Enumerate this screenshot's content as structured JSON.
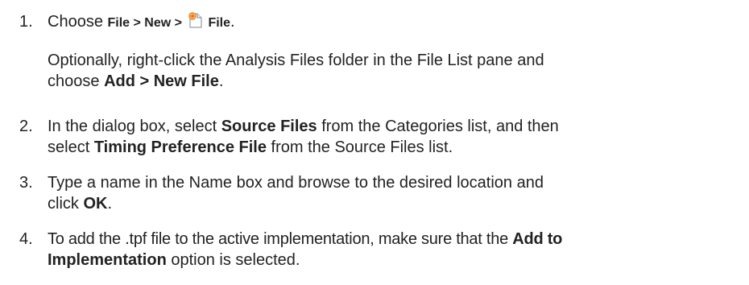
{
  "steps": [
    {
      "number": "1.",
      "prefix": "Choose ",
      "menu_path_1": "File",
      "sep_1": " > ",
      "menu_path_2": "New",
      "sep_2": " > ",
      "icon": "new-file-icon",
      "menu_path_3": "File",
      "suffix": "."
    },
    {
      "number": "2.",
      "line1_prefix": "In the dialog box, select ",
      "line1_bold": "Source Files",
      "line1_suffix": " from the Categories list, and then",
      "line2_prefix": "select ",
      "line2_bold": "Timing Preference File",
      "line2_suffix": " from the Source Files list."
    },
    {
      "number": "3.",
      "line1": "Type a name in the Name box and browse to the desired location and",
      "line2_prefix": "click ",
      "line2_bold": "OK",
      "line2_suffix": "."
    },
    {
      "number": "4.",
      "line1_prefix": "To add the .tpf file to the active implementation, make sure that the ",
      "line1_bold": "Add to",
      "line2_bold": "Implementation",
      "line2_suffix": " option is selected."
    }
  ],
  "optional_para": {
    "line1": "Optionally, right-click the Analysis Files folder in the File List pane and",
    "line2_prefix": "choose ",
    "line2_bold": "Add > New File",
    "line2_suffix": "."
  }
}
